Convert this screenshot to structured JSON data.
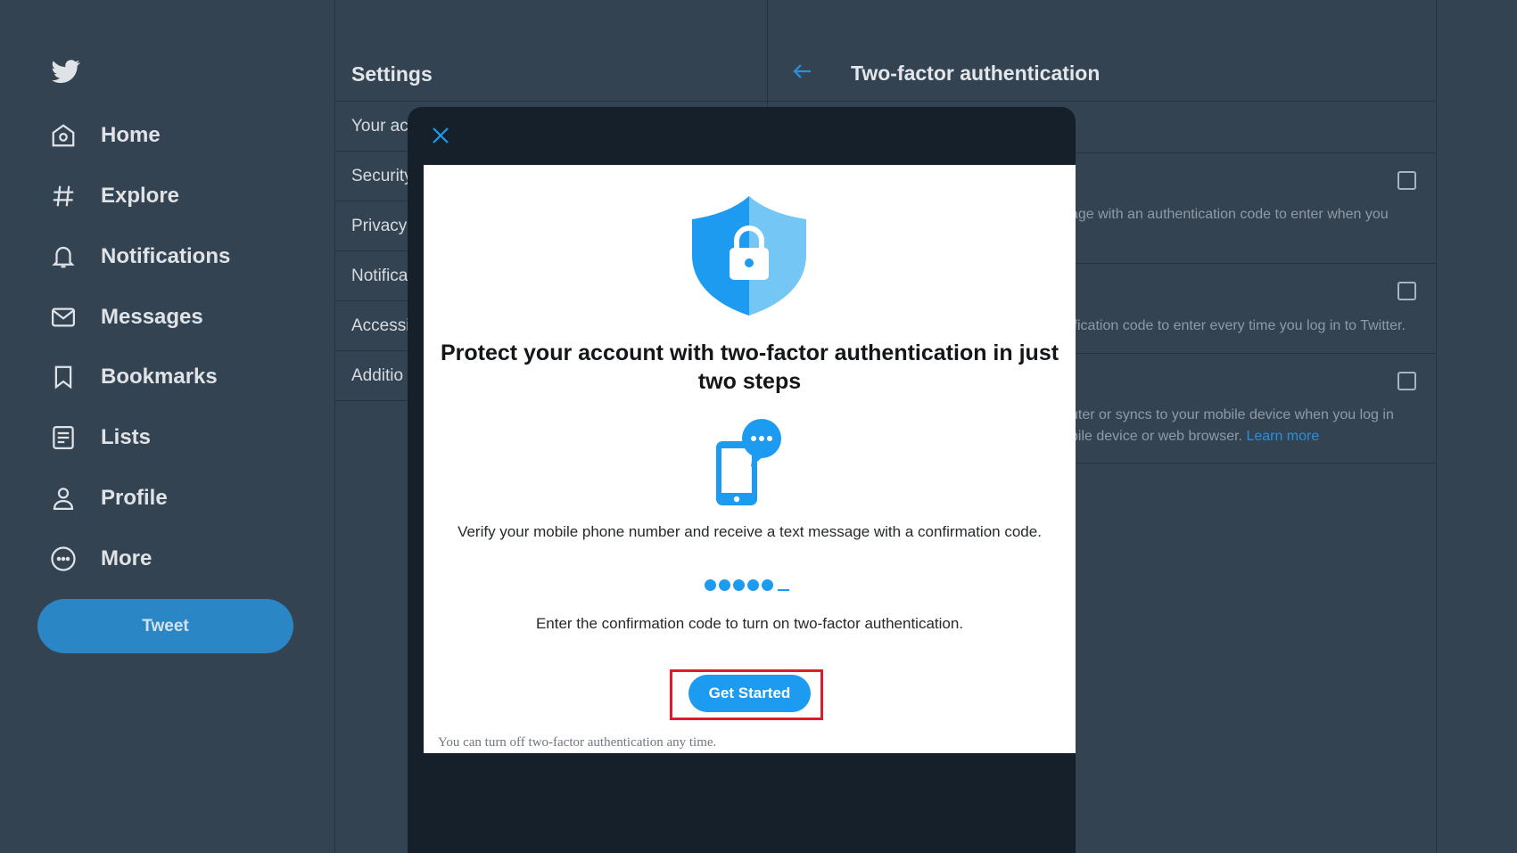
{
  "sidebar": {
    "items": [
      {
        "label": "Home",
        "icon": "home-icon"
      },
      {
        "label": "Explore",
        "icon": "hashtag-icon"
      },
      {
        "label": "Notifications",
        "icon": "bell-icon"
      },
      {
        "label": "Messages",
        "icon": "envelope-icon"
      },
      {
        "label": "Bookmarks",
        "icon": "bookmark-icon"
      },
      {
        "label": "Lists",
        "icon": "list-icon"
      },
      {
        "label": "Profile",
        "icon": "person-icon"
      },
      {
        "label": "More",
        "icon": "more-circle-icon"
      }
    ],
    "tweet_label": "Tweet"
  },
  "settings": {
    "title": "Settings",
    "items": [
      "Your ac",
      "Security",
      "Privacy",
      "Notifica",
      "Accessil",
      "Additio"
    ]
  },
  "detail": {
    "title": "Two-factor authentication",
    "option1_text": "age with an authentication code to enter when you",
    "option2_text": "ification code to enter every time you log in to Twitter.",
    "option3_line1": "uter or syncs to your mobile device when you log in",
    "option3_line2": "bile device or web browser.",
    "learn_more": "Learn more"
  },
  "modal": {
    "title": "Protect your account with two-factor authentication in just two steps",
    "step1": "Verify your mobile phone number and receive a text message with a confirmation code.",
    "step2": "Enter the confirmation code to turn on two-factor authentication.",
    "button_label": "Get Started",
    "footnote": "You can turn off two-factor authentication any time."
  },
  "colors": {
    "background": "#344351",
    "accent": "#1c9bf0",
    "highlight": "#e21b2a",
    "modal_dark": "#16202a"
  }
}
